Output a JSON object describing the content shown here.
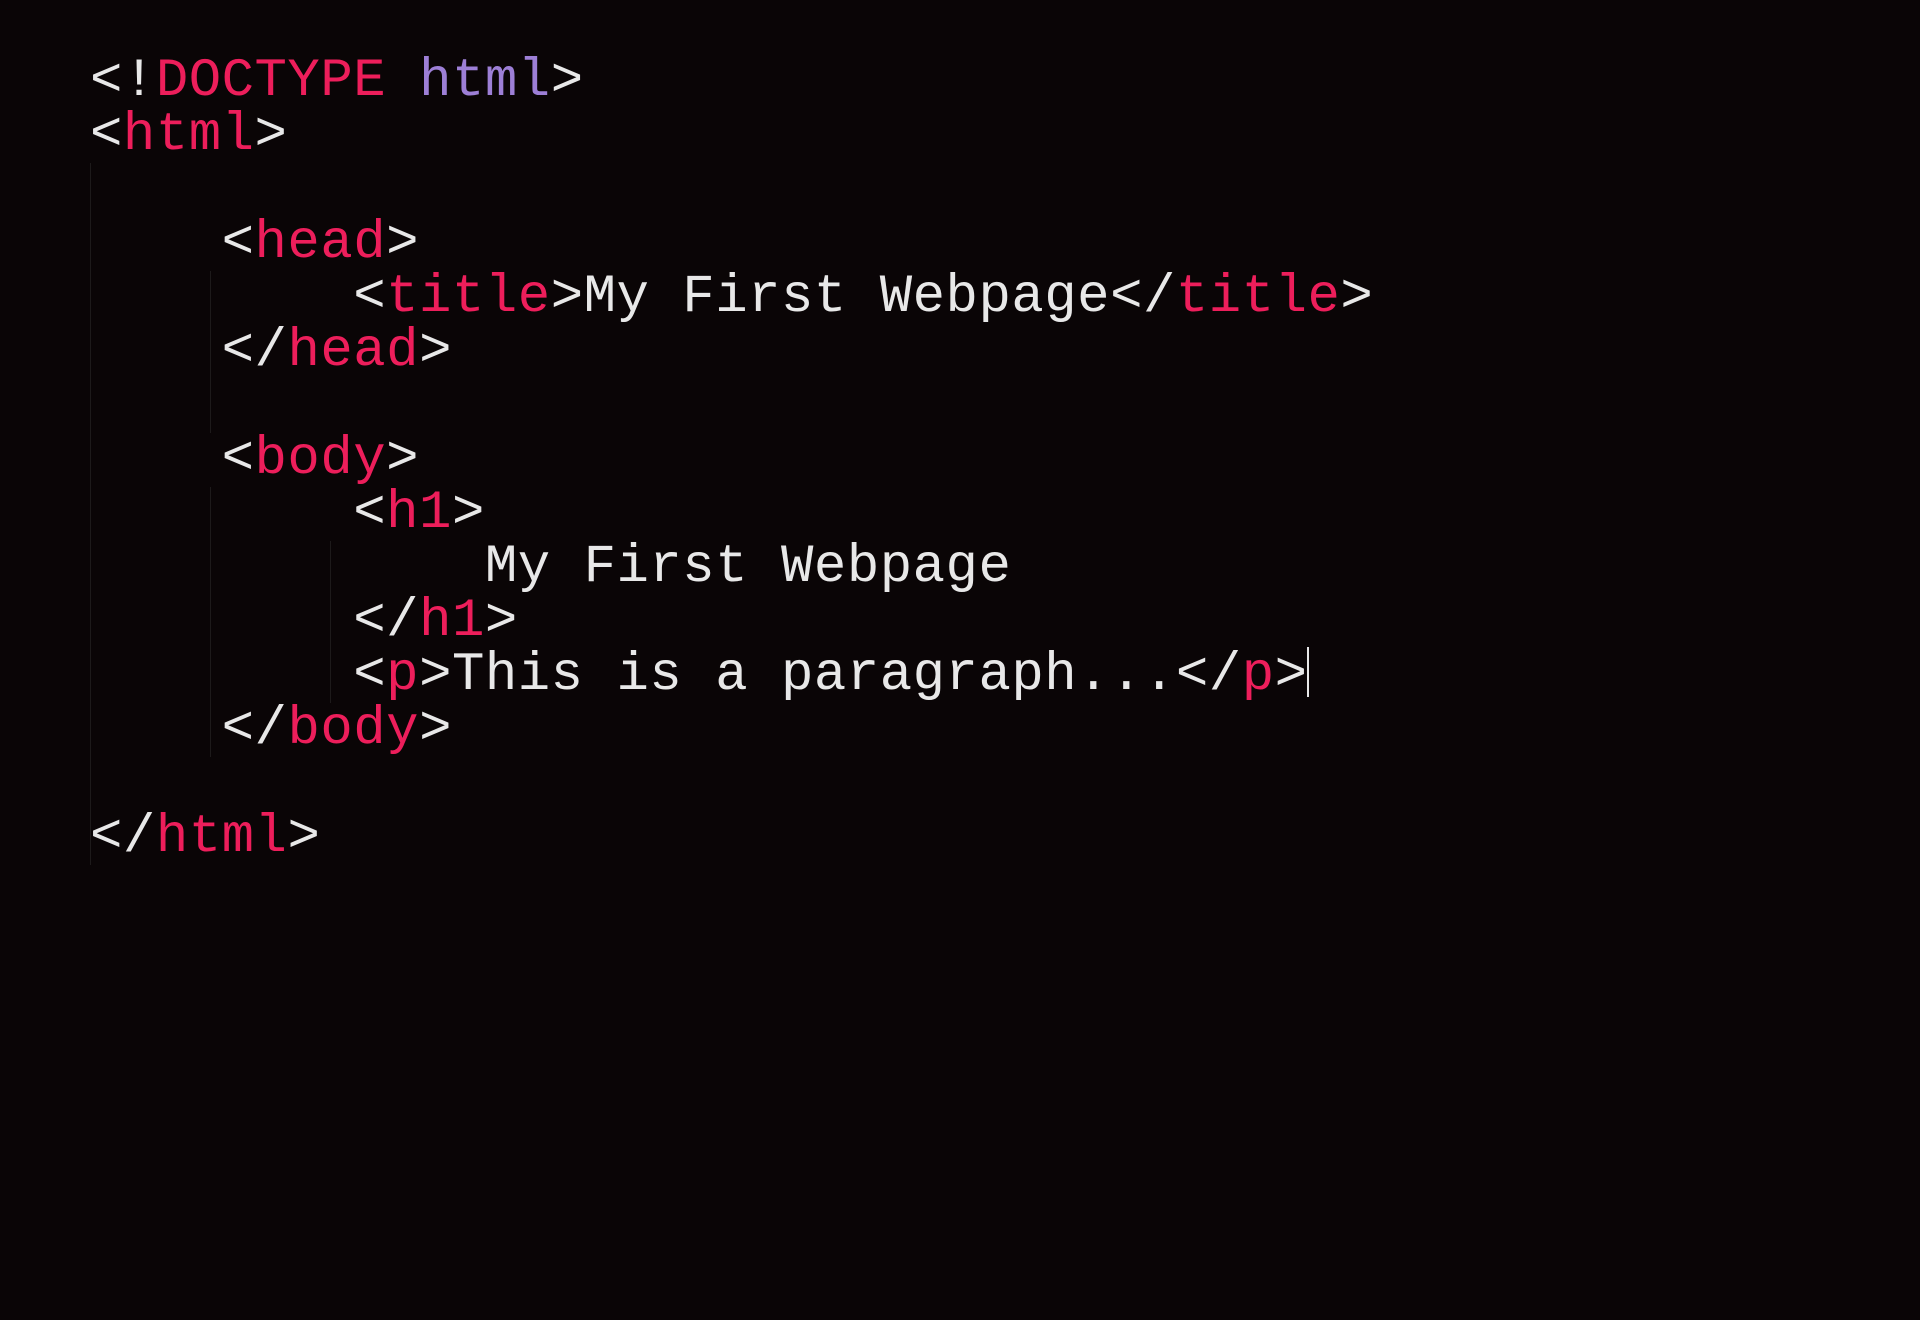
{
  "code": {
    "line1_doctype": "DOCTYPE",
    "line1_html": "html",
    "line2_html": "html",
    "line4_head": "head",
    "line5_title": "title",
    "line5_text": "My First Webpage",
    "line5_title_close": "title",
    "line6_head": "head",
    "line8_body": "body",
    "line9_h1": "h1",
    "line10_text": "My First Webpage",
    "line11_h1": "h1",
    "line12_p": "p",
    "line12_text": "This is a paragraph...",
    "line12_p_close": "p",
    "line13_body": "body",
    "line15_html": "html",
    "indent1": "    ",
    "indent2": "        ",
    "indent3": "            "
  },
  "colors": {
    "background": "#0a0506",
    "tag": "#ed1e5b",
    "attr": "#9d7fd6",
    "text": "#e8e8e8",
    "bracket": "#e8e8e8"
  }
}
